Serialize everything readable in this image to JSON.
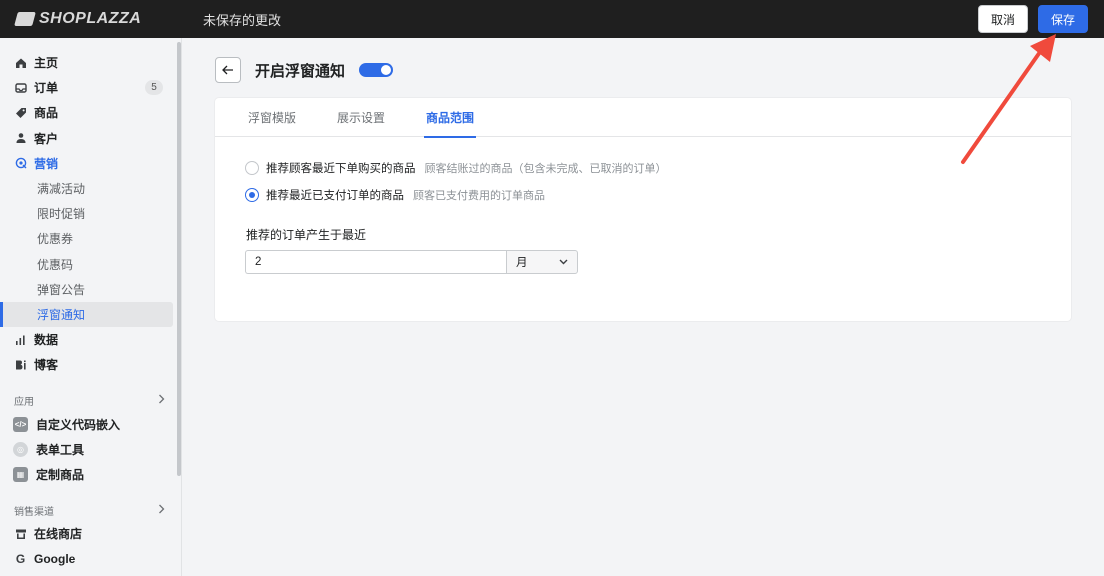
{
  "topbar": {
    "logo_text": "SHOPLAZZA",
    "unsaved_text": "未保存的更改",
    "cancel_label": "取消",
    "save_label": "保存"
  },
  "sidebar": {
    "main_items": [
      {
        "label": "主页",
        "icon": "home-icon"
      },
      {
        "label": "订单",
        "icon": "inbox-icon",
        "badge": "5"
      },
      {
        "label": "商品",
        "icon": "tag-icon"
      },
      {
        "label": "客户",
        "icon": "person-icon"
      },
      {
        "label": "营销",
        "icon": "target-icon"
      }
    ],
    "marketing_sub": [
      "满减活动",
      "限时促销",
      "优惠券",
      "优惠码",
      "弹窗公告",
      "浮窗通知"
    ],
    "more_items": [
      {
        "label": "数据",
        "icon": "bar-chart-icon"
      },
      {
        "label": "博客",
        "icon": "blog-icon"
      }
    ],
    "apps_heading": "应用",
    "apps": [
      {
        "label": "自定义代码嵌入",
        "icon": "code-icon"
      },
      {
        "label": "表单工具",
        "icon": "form-icon"
      },
      {
        "label": "定制商品",
        "icon": "custom-product-icon"
      }
    ],
    "channels_heading": "销售渠道",
    "channels": [
      {
        "label": "在线商店",
        "icon": "store-icon"
      },
      {
        "label": "Google",
        "icon": "google-icon"
      }
    ]
  },
  "page": {
    "title": "开启浮窗通知",
    "toggle_on": true,
    "tabs": [
      "浮窗模版",
      "展示设置",
      "商品范围"
    ],
    "active_tab": 2,
    "options": [
      {
        "label": "推荐顾客最近下单购买的商品",
        "desc": "顾客结账过的商品（包含未完成、已取消的订单）",
        "checked": false
      },
      {
        "label": "推荐最近已支付订单的商品",
        "desc": "顾客已支付费用的订单商品",
        "checked": true
      }
    ],
    "field_label": "推荐的订单产生于最近",
    "field_value": "2",
    "unit_value": "月"
  },
  "colors": {
    "accent": "#2e6be6",
    "annotation_arrow": "#f04a3c"
  }
}
